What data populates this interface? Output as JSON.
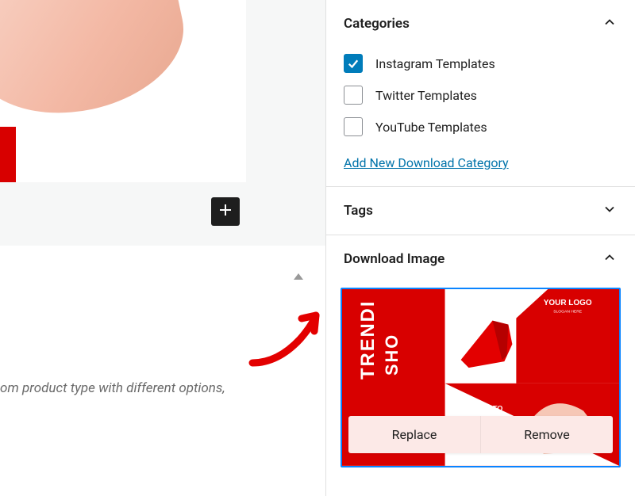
{
  "panels": {
    "categories": {
      "title": "Categories",
      "expanded": true,
      "items": [
        {
          "label": "Instagram Templates",
          "checked": true
        },
        {
          "label": "Twitter Templates",
          "checked": false
        },
        {
          "label": "YouTube Templates",
          "checked": false
        }
      ],
      "add_link": "Add New Download Category"
    },
    "tags": {
      "title": "Tags",
      "expanded": false
    },
    "download_image": {
      "title": "Download Image",
      "expanded": true,
      "thumb": {
        "text_trending": "TRENDI",
        "text_sho": "SHO",
        "text_logo": "YOUR LOGO",
        "text_slogan": "SLOGAN HERE",
        "text_getupto": "GET UPTO"
      },
      "actions": {
        "replace": "Replace",
        "remove": "Remove"
      }
    }
  },
  "left": {
    "description_fragment": "om product type with different options,"
  }
}
